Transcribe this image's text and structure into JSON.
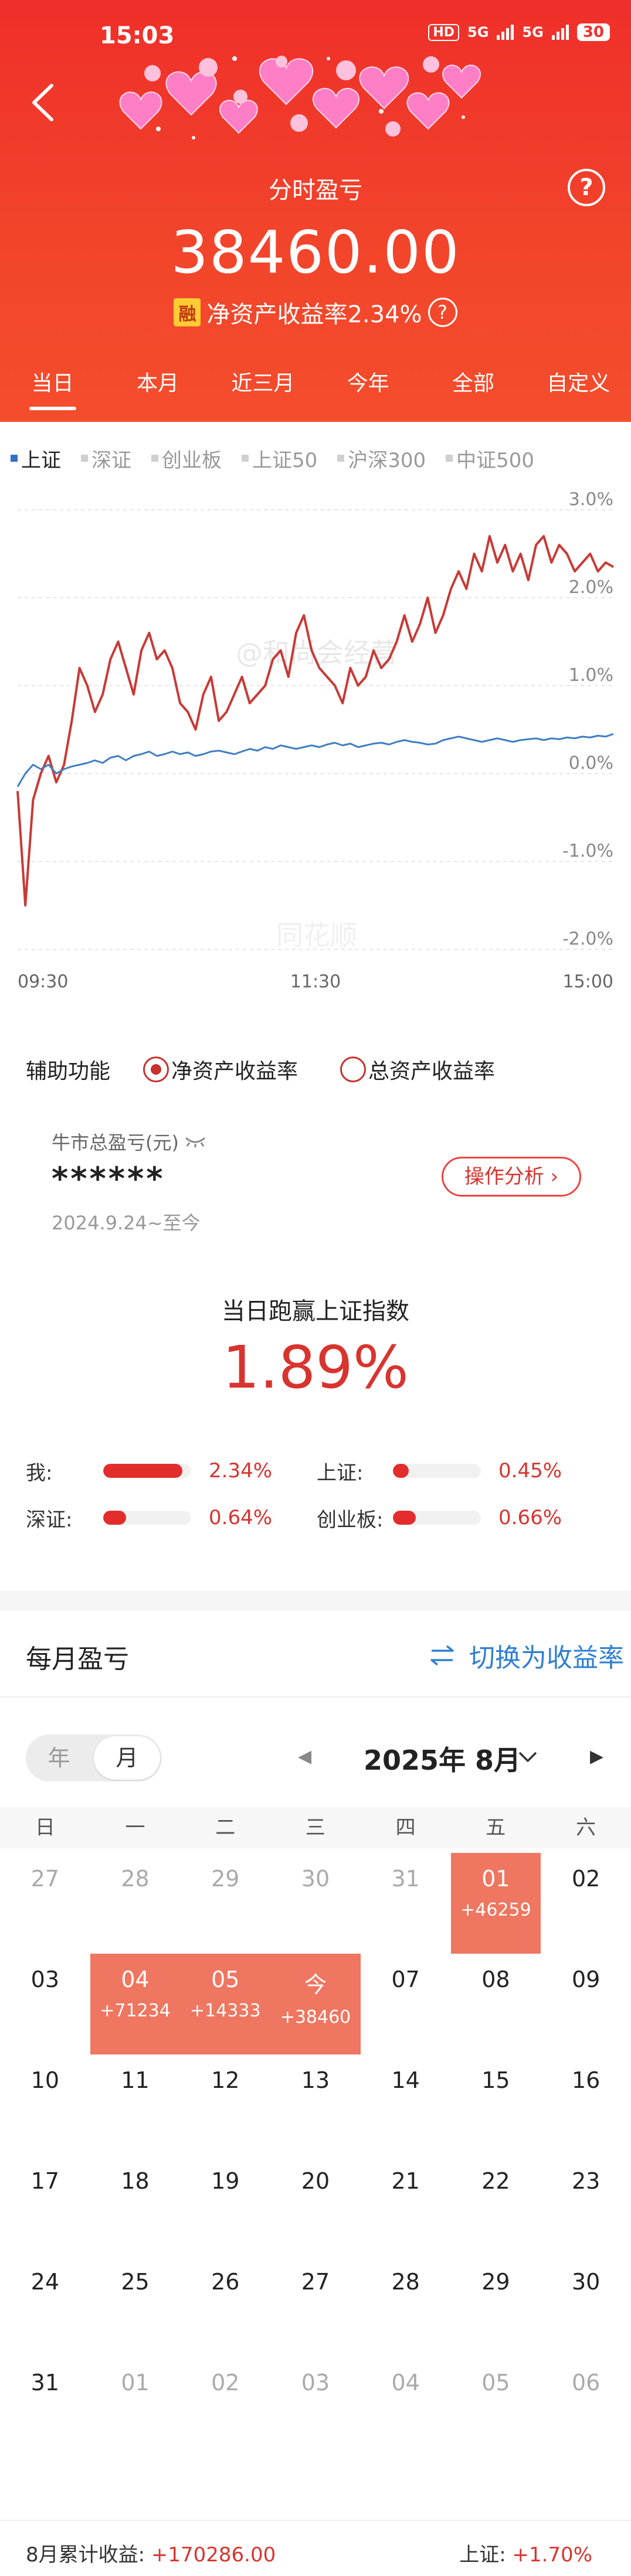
{
  "status_bar": {
    "time": "15:03",
    "network1": "5G",
    "network2": "5G",
    "hd": "HD",
    "battery": "30"
  },
  "header": {
    "title": "分时盈亏",
    "amount": "38460.00",
    "roe_badge": "融",
    "roe_text": "净资产收益率2.34%",
    "help_icon": "?"
  },
  "tabs": [
    "当日",
    "本月",
    "近三月",
    "今年",
    "全部",
    "自定义"
  ],
  "active_tab": "当日",
  "index_tabs": [
    "上证",
    "深证",
    "创业板",
    "上证50",
    "沪深300",
    "中证500"
  ],
  "active_index": "上证",
  "chart_data": {
    "type": "line",
    "x_ticks": [
      "09:30",
      "11:30",
      "15:00"
    ],
    "y_ticks": [
      "3.0%",
      "2.0%",
      "1.0%",
      "0.0%",
      "-1.0%",
      "-2.0%"
    ],
    "ylim": [
      -2.0,
      3.0
    ],
    "grid": true,
    "watermark_center": "和尚会经营",
    "watermark_bottom": "同花顺",
    "series": [
      {
        "color": "#c83a36",
        "values": [
          -0.2,
          -1.5,
          -0.3,
          0.0,
          0.2,
          -0.1,
          0.1,
          0.6,
          1.2,
          1.0,
          0.7,
          0.9,
          1.3,
          1.5,
          1.2,
          0.9,
          1.4,
          1.6,
          1.3,
          1.4,
          1.2,
          0.8,
          0.7,
          0.5,
          0.9,
          1.1,
          0.6,
          0.7,
          0.9,
          1.1,
          0.8,
          0.9,
          1.0,
          1.3,
          1.4,
          1.1,
          1.6,
          1.8,
          1.4,
          1.2,
          1.1,
          1.0,
          0.8,
          1.2,
          1.0,
          1.1,
          1.4,
          1.2,
          1.3,
          1.5,
          1.8,
          1.5,
          1.7,
          2.0,
          1.6,
          1.8,
          2.1,
          2.3,
          2.1,
          2.5,
          2.3,
          2.7,
          2.4,
          2.6,
          2.3,
          2.5,
          2.2,
          2.6,
          2.7,
          2.4,
          2.6,
          2.5,
          2.3,
          2.4,
          2.5,
          2.3,
          2.4,
          2.35
        ]
      },
      {
        "color": "#3f7dc3",
        "values": [
          -0.15,
          0.0,
          0.1,
          0.05,
          0.1,
          0.0,
          0.05,
          0.08,
          0.1,
          0.12,
          0.15,
          0.12,
          0.18,
          0.2,
          0.15,
          0.2,
          0.22,
          0.25,
          0.2,
          0.22,
          0.25,
          0.22,
          0.24,
          0.2,
          0.22,
          0.25,
          0.26,
          0.24,
          0.22,
          0.25,
          0.28,
          0.26,
          0.3,
          0.28,
          0.32,
          0.3,
          0.28,
          0.3,
          0.32,
          0.3,
          0.33,
          0.35,
          0.32,
          0.34,
          0.3,
          0.32,
          0.34,
          0.35,
          0.33,
          0.36,
          0.38,
          0.36,
          0.35,
          0.33,
          0.34,
          0.38,
          0.4,
          0.42,
          0.4,
          0.38,
          0.36,
          0.38,
          0.4,
          0.38,
          0.36,
          0.38,
          0.39,
          0.4,
          0.38,
          0.4,
          0.39,
          0.41,
          0.4,
          0.42,
          0.41,
          0.43,
          0.42,
          0.45
        ]
      }
    ]
  },
  "assist": {
    "label": "辅助功能",
    "options": [
      "净资产收益率",
      "总资产收益率"
    ],
    "selected": "净资产收益率"
  },
  "bull_market": {
    "label": "牛市总盈亏(元)",
    "value": "******",
    "date_range": "2024.9.24~至今",
    "action": "操作分析 ›"
  },
  "beat": {
    "title": "当日跑赢上证指数",
    "percent": "1.89%"
  },
  "comparison": [
    {
      "label": "我:",
      "value": "2.34%",
      "fill": 0.9
    },
    {
      "label": "上证:",
      "value": "0.45%",
      "fill": 0.18
    },
    {
      "label": "深证:",
      "value": "0.64%",
      "fill": 0.26
    },
    {
      "label": "创业板:",
      "value": "0.66%",
      "fill": 0.26
    }
  ],
  "monthly": {
    "title": "每月盈亏",
    "switch_label": "切换为收益率",
    "segment": [
      "年",
      "月"
    ],
    "segment_active": "月",
    "month_label": "2025年 8月",
    "weekdays": [
      "日",
      "一",
      "二",
      "三",
      "四",
      "五",
      "六"
    ],
    "weeks": [
      [
        {
          "d": "27",
          "o": true
        },
        {
          "d": "28",
          "o": true
        },
        {
          "d": "29",
          "o": true
        },
        {
          "d": "30",
          "o": true
        },
        {
          "d": "31",
          "o": true
        },
        {
          "d": "01",
          "p": "+46259",
          "h": true
        },
        {
          "d": "02"
        }
      ],
      [
        {
          "d": "03"
        },
        {
          "d": "04",
          "p": "+71234",
          "h": true
        },
        {
          "d": "05",
          "p": "+14333",
          "h": true
        },
        {
          "d": "今",
          "p": "+38460",
          "h": true
        },
        {
          "d": "07"
        },
        {
          "d": "08"
        },
        {
          "d": "09"
        }
      ],
      [
        {
          "d": "10"
        },
        {
          "d": "11"
        },
        {
          "d": "12"
        },
        {
          "d": "13"
        },
        {
          "d": "14"
        },
        {
          "d": "15"
        },
        {
          "d": "16"
        }
      ],
      [
        {
          "d": "17"
        },
        {
          "d": "18"
        },
        {
          "d": "19"
        },
        {
          "d": "20"
        },
        {
          "d": "21"
        },
        {
          "d": "22"
        },
        {
          "d": "23"
        }
      ],
      [
        {
          "d": "24"
        },
        {
          "d": "25"
        },
        {
          "d": "26"
        },
        {
          "d": "27"
        },
        {
          "d": "28"
        },
        {
          "d": "29"
        },
        {
          "d": "30"
        }
      ],
      [
        {
          "d": "31"
        },
        {
          "d": "01",
          "o": true
        },
        {
          "d": "02",
          "o": true
        },
        {
          "d": "03",
          "o": true
        },
        {
          "d": "04",
          "o": true
        },
        {
          "d": "05",
          "o": true
        },
        {
          "d": "06",
          "o": true
        }
      ]
    ]
  },
  "footer": {
    "cum_label": "8月累计收益:",
    "cum_value": "+170286.00",
    "index_label": "上证:",
    "index_value": "+1.70%"
  }
}
